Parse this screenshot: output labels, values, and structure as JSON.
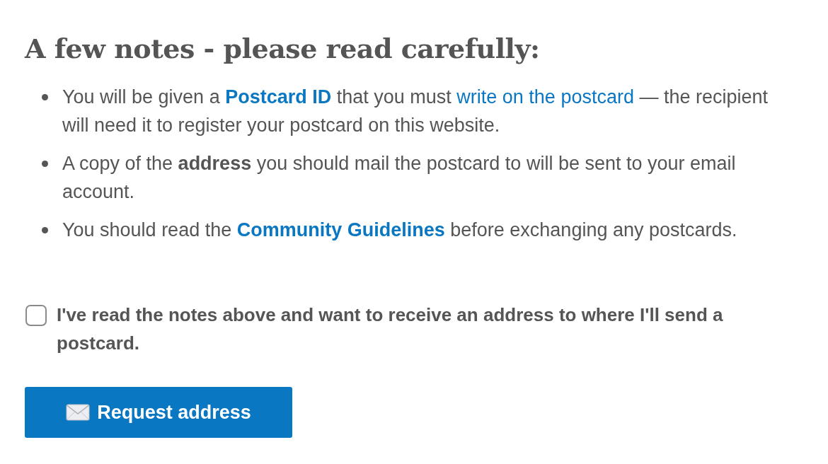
{
  "heading": "A few notes - please read carefully:",
  "notes": [
    {
      "segments": [
        {
          "kind": "plain",
          "text": "You will be given a "
        },
        {
          "kind": "bold-link",
          "text": "Postcard ID"
        },
        {
          "kind": "plain",
          "text": " that you must "
        },
        {
          "kind": "link",
          "text": "write on the postcard"
        },
        {
          "kind": "plain",
          "text": " — the recipient will need it to register your postcard on this website."
        }
      ]
    },
    {
      "segments": [
        {
          "kind": "plain",
          "text": "A copy of the "
        },
        {
          "kind": "bold",
          "text": "address"
        },
        {
          "kind": "plain",
          "text": " you should mail the postcard to will be sent to your email account."
        }
      ]
    },
    {
      "segments": [
        {
          "kind": "plain",
          "text": "You should read the "
        },
        {
          "kind": "bold-link",
          "text": "Community Guidelines"
        },
        {
          "kind": "plain",
          "text": " before exchanging any postcards."
        }
      ]
    }
  ],
  "agreement": {
    "label": "I've read the notes above and want to receive an address to where I'll send a postcard.",
    "checked": false
  },
  "button": {
    "label": "Request address"
  }
}
